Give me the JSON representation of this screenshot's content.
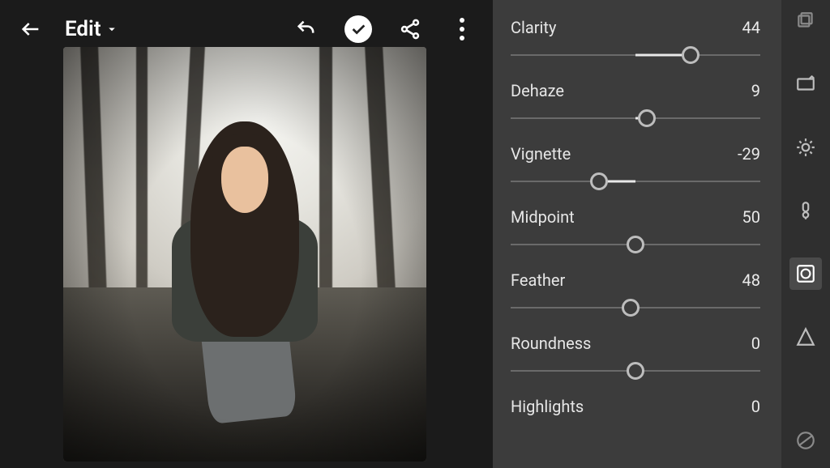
{
  "header": {
    "title": "Edit"
  },
  "sliders": [
    {
      "name": "Clarity",
      "value": 44,
      "min": -100,
      "max": 100
    },
    {
      "name": "Dehaze",
      "value": 9,
      "min": -100,
      "max": 100
    },
    {
      "name": "Vignette",
      "value": -29,
      "min": -100,
      "max": 100
    },
    {
      "name": "Midpoint",
      "value": 50,
      "min": 0,
      "max": 100
    },
    {
      "name": "Feather",
      "value": 48,
      "min": 0,
      "max": 100
    },
    {
      "name": "Roundness",
      "value": 0,
      "min": -100,
      "max": 100
    },
    {
      "name": "Highlights",
      "value": 0,
      "min": -100,
      "max": 100
    }
  ],
  "tools": [
    {
      "id": "stack",
      "label": "stack-icon",
      "active": false
    },
    {
      "id": "adjust",
      "label": "auto-icon",
      "active": false
    },
    {
      "id": "light",
      "label": "light-icon",
      "active": false
    },
    {
      "id": "color",
      "label": "color-icon",
      "active": false
    },
    {
      "id": "effects",
      "label": "effects-icon",
      "active": true
    },
    {
      "id": "detail",
      "label": "detail-icon",
      "active": false
    },
    {
      "id": "optics",
      "label": "optics-icon",
      "active": false
    }
  ]
}
